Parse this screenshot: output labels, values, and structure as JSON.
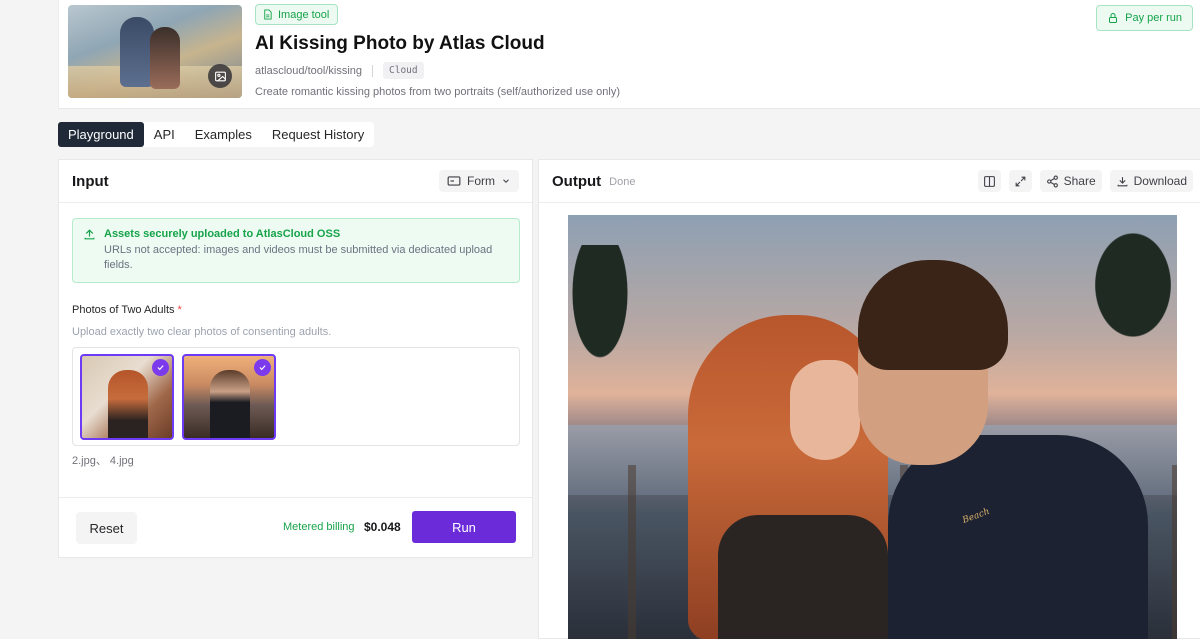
{
  "header": {
    "tag_label": "Image tool",
    "title": "AI Kissing Photo by Atlas Cloud",
    "path": "atlascloud/tool/kissing",
    "chip": "Cloud",
    "description": "Create romantic kissing photos from two portraits (self/authorized use only)",
    "pay_label": "Pay per run"
  },
  "tabs": [
    {
      "label": "Playground",
      "active": true
    },
    {
      "label": "API",
      "active": false
    },
    {
      "label": "Examples",
      "active": false
    },
    {
      "label": "Request History",
      "active": false
    }
  ],
  "input": {
    "title": "Input",
    "form_toggle": "Form",
    "notice": {
      "title": "Assets securely uploaded to AtlasCloud OSS",
      "text": "URLs not accepted: images and videos must be submitted via dedicated upload fields."
    },
    "field_label": "Photos of Two Adults",
    "required_mark": "*",
    "field_help": "Upload exactly two clear photos of consenting adults.",
    "files_text": "2.jpg、 4.jpg",
    "reset_label": "Reset",
    "billing_label": "Metered billing",
    "price": "$0.048",
    "run_label": "Run"
  },
  "output": {
    "title": "Output",
    "status": "Done",
    "share_label": "Share",
    "download_label": "Download",
    "shirt_print": "Beach"
  },
  "colors": {
    "accent": "#6c2bd9",
    "green": "#16a34a",
    "dark_tab": "#1f2937"
  }
}
